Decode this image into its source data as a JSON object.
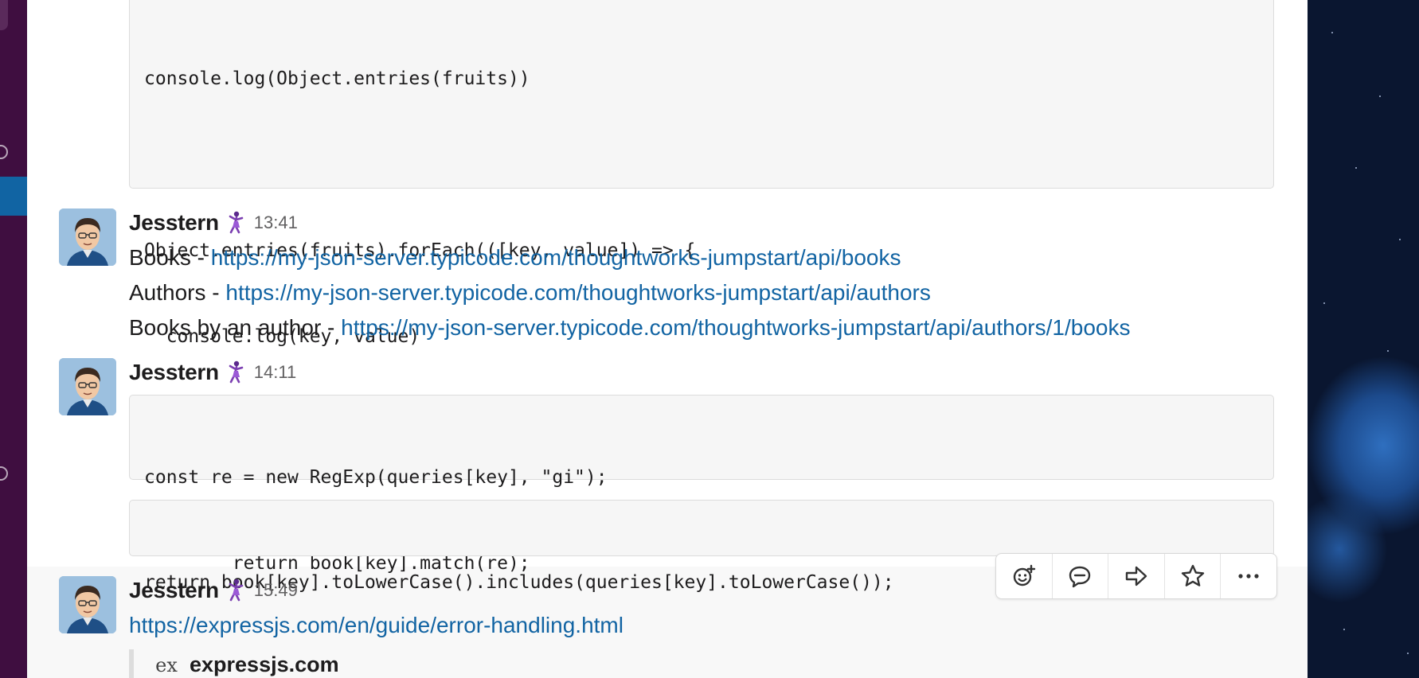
{
  "code_blocks": [
    {
      "lines": [
        "console.log(Object.entries(fruits))",
        "",
        "Object.entries(fruits).forEach(([key, value]) => {",
        "  console.log(key, value)",
        "})"
      ]
    },
    {
      "lines": [
        "const re = new RegExp(queries[key], \"gi\");",
        "        return book[key].match(re);"
      ]
    },
    {
      "lines": [
        "return book[key].toLowerCase().includes(queries[key].toLowerCase());"
      ]
    }
  ],
  "messages": [
    {
      "author": "Jesstern",
      "time": "13:41",
      "lines": [
        {
          "prefix": "Books - ",
          "link": "https://my-json-server.typicode.com/thoughtworks-jumpstart/api/books"
        },
        {
          "prefix": "Authors - ",
          "link": "https://my-json-server.typicode.com/thoughtworks-jumpstart/api/authors"
        },
        {
          "prefix": "Books by an author - ",
          "link": "https://my-json-server.typicode.com/thoughtworks-jumpstart/api/authors/1/books"
        }
      ]
    },
    {
      "author": "Jesstern",
      "time": "14:11"
    },
    {
      "author": "Jesstern",
      "time": "15:49",
      "link": "https://expressjs.com/en/guide/error-handling.html",
      "unfurl": {
        "icon_text": "ex",
        "site": "expressjs.com"
      }
    }
  ],
  "icons": {
    "status": "dancer-emoji-icon",
    "toolbar": [
      "add-reaction-icon",
      "reply-in-thread-icon",
      "share-message-icon",
      "save-star-icon",
      "more-actions-icon"
    ]
  },
  "colors": {
    "sidebar": "#3f0e40",
    "sidebar_active": "#1164a3",
    "link": "#1264a3",
    "text": "#1d1c1d",
    "timestamp": "#616061"
  }
}
